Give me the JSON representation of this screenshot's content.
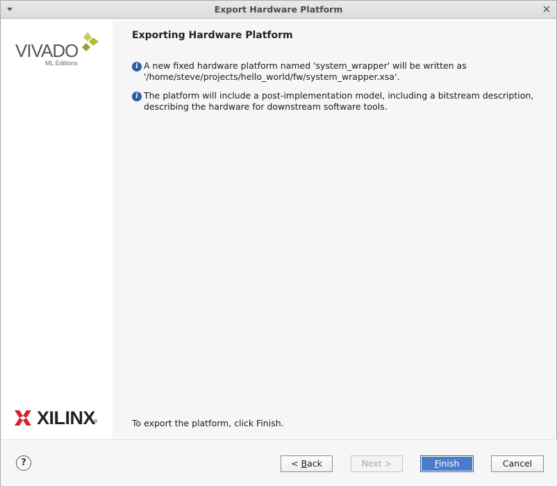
{
  "window": {
    "title": "Export Hardware Platform"
  },
  "sidebar": {
    "vivado_logo": {
      "word": "VIVADO",
      "sub": "ML Editions",
      "reg": "."
    },
    "xilinx_logo": {
      "word": "XILINX",
      "reg": "."
    }
  },
  "page": {
    "title": "Exporting Hardware Platform",
    "info": [
      {
        "icon": "info-icon",
        "text": "A new fixed hardware platform named 'system_wrapper' will be written as '/home/steve/projects/hello_world/fw/system_wrapper.xsa'."
      },
      {
        "icon": "info-icon",
        "text": "The platform will include a post-implementation model, including a bitstream description, describing the hardware for downstream software tools."
      }
    ],
    "footer_note": "To export the platform, click Finish."
  },
  "buttons": {
    "help": "?",
    "back_prefix": "< ",
    "back_mnemonic": "B",
    "back_rest": "ack",
    "next": "Next >",
    "finish_mnemonic": "F",
    "finish_rest": "inish",
    "cancel": "Cancel"
  },
  "colors": {
    "accent": "#4a7cc9",
    "info_icon": "#2c5fa3",
    "xilinx_red": "#d4212e",
    "vivado_green": "#b5b934"
  }
}
